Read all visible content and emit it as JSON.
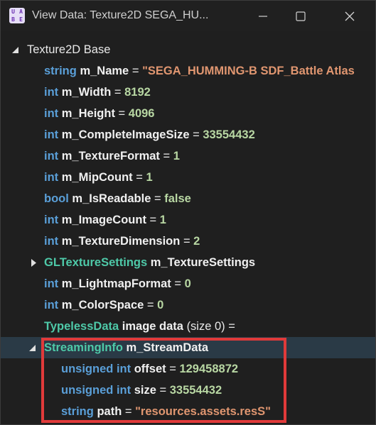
{
  "window": {
    "title": "View Data: Texture2D SEGA_HU...",
    "app_icon_letters": [
      "U",
      "A",
      "B",
      "E"
    ]
  },
  "tree": {
    "root_label": "Texture2D Base",
    "rows": [
      {
        "type": "string",
        "name": "m_Name",
        "eq": "=",
        "value": "\"SEGA_HUMMING-B SDF_Battle Atlas"
      },
      {
        "type": "int",
        "name": "m_Width",
        "eq": "=",
        "value": "8192"
      },
      {
        "type": "int",
        "name": "m_Height",
        "eq": "=",
        "value": "4096"
      },
      {
        "type": "int",
        "name": "m_CompleteImageSize",
        "eq": "=",
        "value": "33554432"
      },
      {
        "type": "int",
        "name": "m_TextureFormat",
        "eq": "=",
        "value": "1"
      },
      {
        "type": "int",
        "name": "m_MipCount",
        "eq": "=",
        "value": "1"
      },
      {
        "type": "bool",
        "name": "m_IsReadable",
        "eq": "=",
        "value": "false"
      },
      {
        "type": "int",
        "name": "m_ImageCount",
        "eq": "=",
        "value": "1"
      },
      {
        "type": "int",
        "name": "m_TextureDimension",
        "eq": "=",
        "value": "2"
      },
      {
        "type": "GLTextureSettings",
        "name": "m_TextureSettings"
      },
      {
        "type": "int",
        "name": "m_LightmapFormat",
        "eq": "=",
        "value": "0"
      },
      {
        "type": "int",
        "name": "m_ColorSpace",
        "eq": "=",
        "value": "0"
      },
      {
        "type": "TypelessData",
        "name": "image data",
        "extra": "(size 0)",
        "eq": "="
      },
      {
        "type": "StreamingInfo",
        "name": "m_StreamData"
      }
    ],
    "stream_children": [
      {
        "type_kw": "unsigned",
        "type": "int",
        "name": "offset",
        "eq": "=",
        "value": "129458872"
      },
      {
        "type_kw": "unsigned",
        "type": "int",
        "name": "size",
        "eq": "=",
        "value": "33554432"
      },
      {
        "type": "string",
        "name": "path",
        "eq": "=",
        "value": "\"resources.assets.resS\""
      }
    ]
  },
  "colors": {
    "keyword": "#5a9fd8",
    "custom_type": "#4ec9a8",
    "string_value": "#e09670",
    "number_value": "#b8d7a3",
    "highlight_box": "#e03a3a",
    "selected_row": "#2a3a46"
  }
}
